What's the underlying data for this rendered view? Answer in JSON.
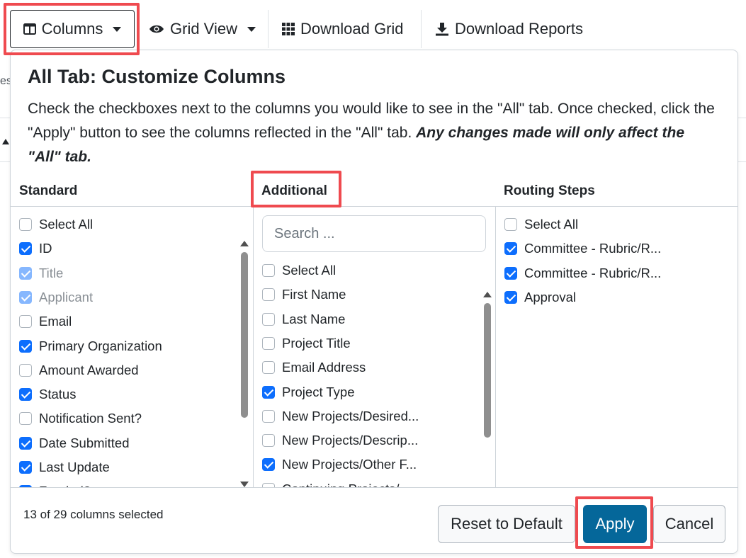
{
  "toolbar": {
    "columns_label": "Columns",
    "grid_view_label": "Grid View",
    "download_grid_label": "Download Grid",
    "download_reports_label": "Download Reports"
  },
  "background": {
    "fragment_es": "es"
  },
  "popover": {
    "title": "All Tab: Customize Columns",
    "description": "Check the checkboxes next to the columns you would like to see in the \"All\" tab. Once checked, click the \"Apply\" button to see the columns reflected in the \"All\" tab. ",
    "description_emphasis": "Any changes made will only affect the \"All\" tab.",
    "standard": {
      "heading": "Standard",
      "items": [
        {
          "label": "Select All",
          "checked": false,
          "disabled": false
        },
        {
          "label": "ID",
          "checked": true,
          "disabled": false
        },
        {
          "label": "Title",
          "checked": true,
          "disabled": true
        },
        {
          "label": "Applicant",
          "checked": true,
          "disabled": true
        },
        {
          "label": "Email",
          "checked": false,
          "disabled": false
        },
        {
          "label": "Primary Organization",
          "checked": true,
          "disabled": false
        },
        {
          "label": "Amount Awarded",
          "checked": false,
          "disabled": false
        },
        {
          "label": "Status",
          "checked": true,
          "disabled": false
        },
        {
          "label": "Notification Sent?",
          "checked": false,
          "disabled": false
        },
        {
          "label": "Date Submitted",
          "checked": true,
          "disabled": false
        },
        {
          "label": "Last Update",
          "checked": true,
          "disabled": false
        },
        {
          "label": "Funded?",
          "checked": true,
          "disabled": false
        }
      ]
    },
    "additional": {
      "heading": "Additional",
      "search_placeholder": "Search ...",
      "items": [
        {
          "label": "Select All",
          "checked": false
        },
        {
          "label": "First Name",
          "checked": false
        },
        {
          "label": "Last Name",
          "checked": false
        },
        {
          "label": "Project Title",
          "checked": false
        },
        {
          "label": "Email Address",
          "checked": false
        },
        {
          "label": "Project Type",
          "checked": true
        },
        {
          "label": "New Projects/Desired...",
          "checked": false
        },
        {
          "label": "New Projects/Descrip...",
          "checked": false
        },
        {
          "label": "New Projects/Other F...",
          "checked": true
        },
        {
          "label": "Continuing Projects/...",
          "checked": false
        }
      ]
    },
    "routing": {
      "heading": "Routing Steps",
      "items": [
        {
          "label": "Select All",
          "checked": false
        },
        {
          "label": "Committee - Rubric/R...",
          "checked": true
        },
        {
          "label": "Committee - Rubric/R...",
          "checked": true
        },
        {
          "label": "Approval",
          "checked": true
        }
      ]
    },
    "footer": {
      "count_text": "13 of 29 columns selected",
      "reset_label": "Reset to Default",
      "apply_label": "Apply",
      "cancel_label": "Cancel"
    }
  },
  "colors": {
    "highlight": "#ef4a4f",
    "checkbox_checked": "#0d6efd",
    "apply_button": "#05679a"
  }
}
